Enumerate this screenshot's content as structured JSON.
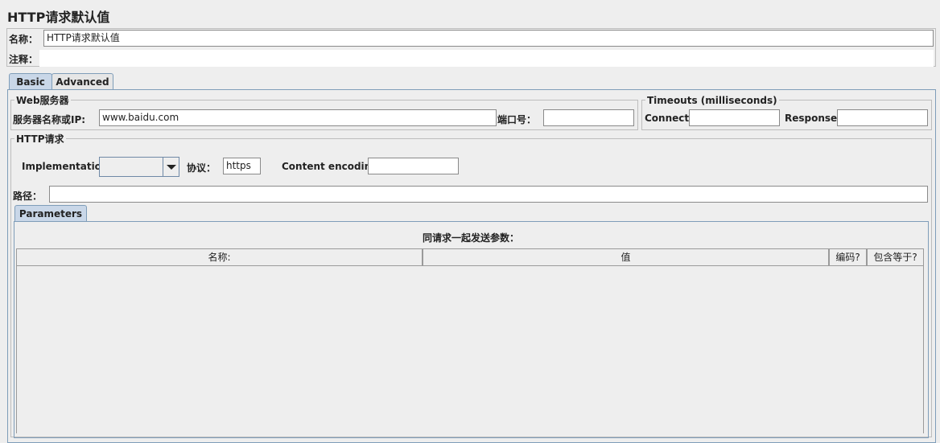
{
  "page": {
    "title": "HTTP请求默认值"
  },
  "form": {
    "name_label": "名称：",
    "name_value": "HTTP请求默认值",
    "comment_label": "注释：",
    "comment_value": ""
  },
  "tabs": [
    {
      "label": "Basic",
      "selected": true
    },
    {
      "label": "Advanced",
      "selected": false
    }
  ],
  "web_server": {
    "legend": "Web服务器",
    "server_label": "服务器名称或IP:",
    "server_value": "www.baidu.com",
    "port_label": "端口号：",
    "port_value": ""
  },
  "timeouts": {
    "legend": "Timeouts (milliseconds)",
    "connect_label": "Connect:",
    "connect_value": "",
    "response_label": "Response:",
    "response_value": ""
  },
  "http_request": {
    "legend": "HTTP请求",
    "implementation_label": "Implementation:",
    "implementation_value": "",
    "protocol_label": "协议：",
    "protocol_value": "https",
    "encoding_label": "Content encoding:",
    "encoding_value": "",
    "path_label": "路径：",
    "path_value": ""
  },
  "parameters": {
    "tab_label": "Parameters",
    "table_title": "同请求一起发送参数：",
    "columns": [
      "名称:",
      "值",
      "编码?",
      "包含等于?"
    ],
    "rows": []
  },
  "colors": {
    "background": "#eeeeee",
    "selected_tab": "#c9d7e8",
    "tab_border": "#7f9db9"
  }
}
